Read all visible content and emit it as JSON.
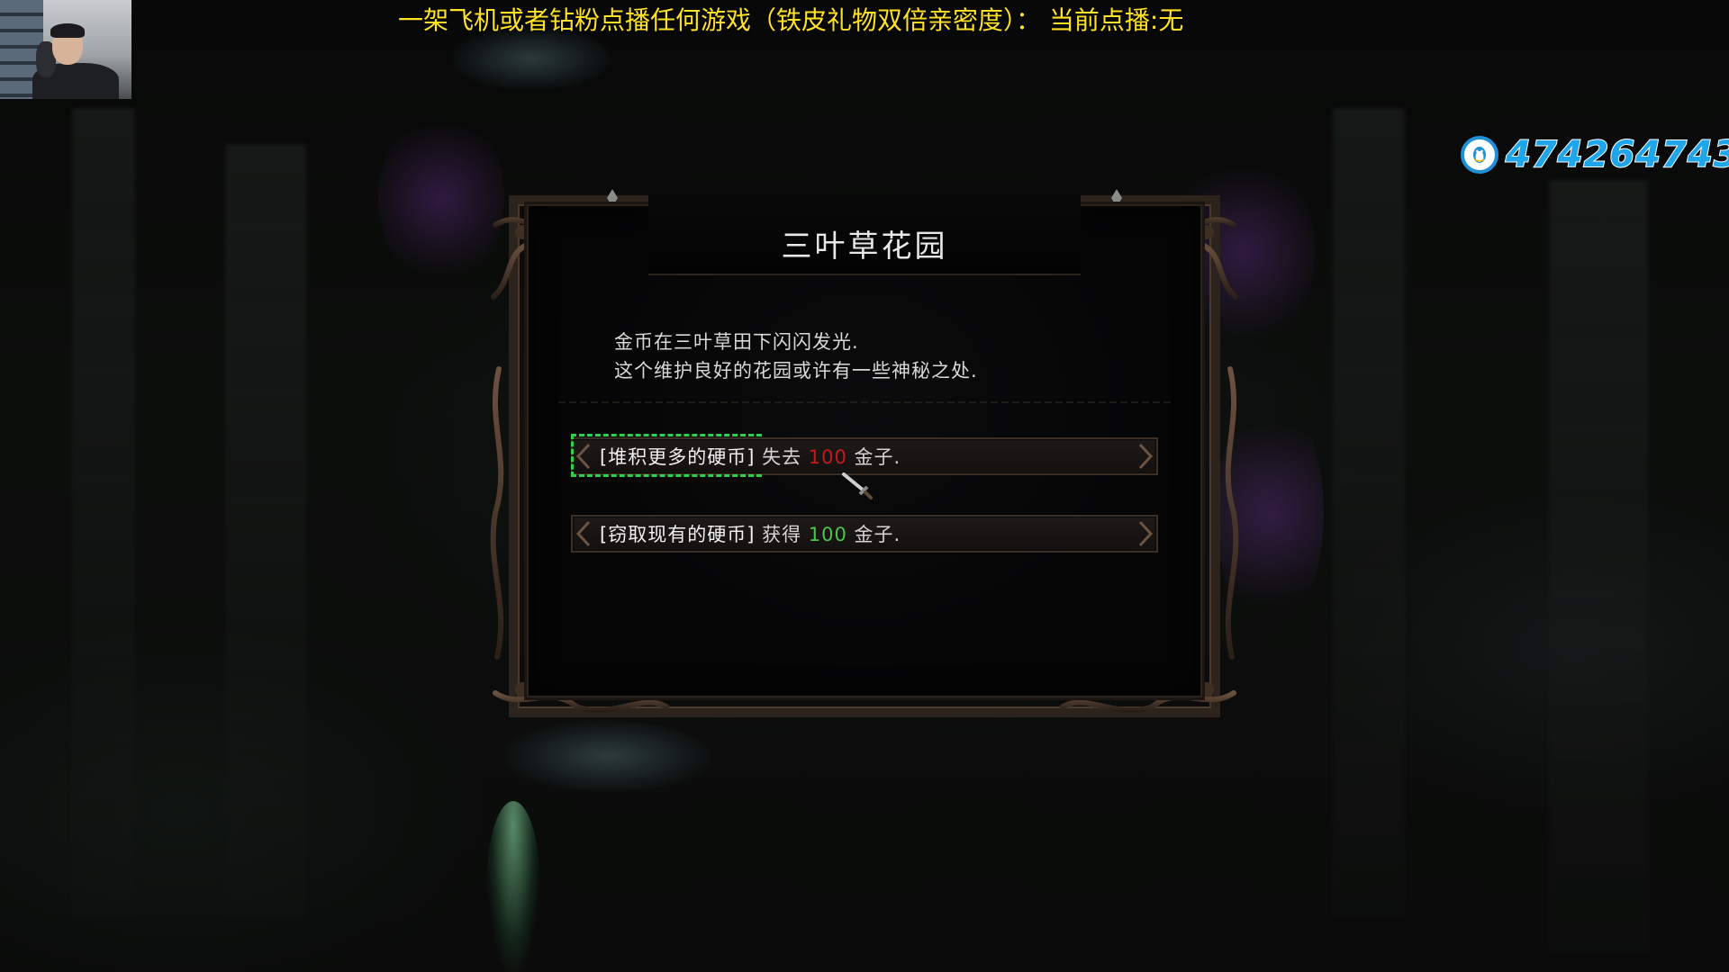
{
  "stream": {
    "banner_text": "一架飞机或者钻粉点播任何游戏（铁皮礼物双倍亲密度）： 当前点播:无",
    "qq_number": "474264743",
    "banner_color": "#ffe227",
    "qq_color": "#1fa5ea"
  },
  "event": {
    "title": "三叶草花园",
    "description_lines": [
      "金币在三叶草田下闪闪发光.",
      "这个维护良好的花园或许有一些神秘之处."
    ],
    "choices": [
      {
        "tag": "[堆积更多的硬币]",
        "verb": "失去",
        "amount": "100",
        "suffix": "金子.",
        "amount_color": "#c21b1b",
        "selected": true
      },
      {
        "tag": "[窃取现有的硬币]",
        "verb": "获得",
        "amount": "100",
        "suffix": "金子.",
        "amount_color": "#4fc34f",
        "selected": false
      }
    ]
  },
  "icons": {
    "qq": "qq-penguin-icon",
    "cursor": "sword-cursor-icon"
  }
}
